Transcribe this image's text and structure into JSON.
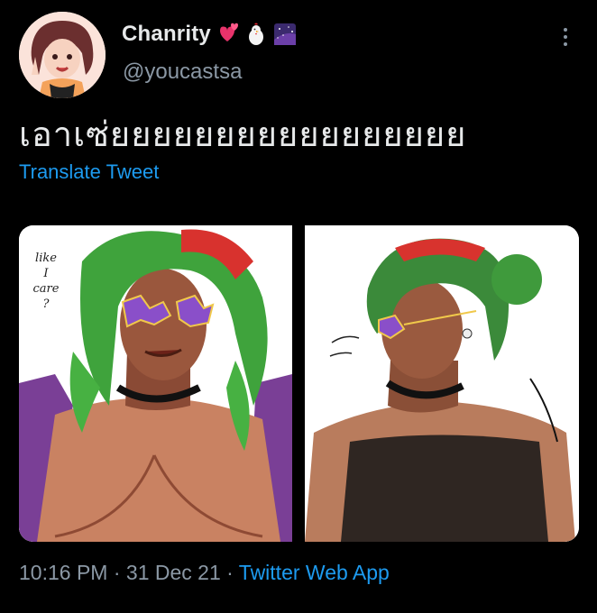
{
  "user": {
    "display_name": "Chanrity",
    "handle": "@youcastsa",
    "badges": [
      "heart-icon",
      "chicken-icon",
      "galaxy-icon"
    ]
  },
  "tweet": {
    "text": "เอาเซ่ยยยยยยยยยยยยยยยยย",
    "translate_label": "Translate Tweet"
  },
  "media": {
    "left_annotation": [
      "like",
      "I",
      "care",
      "?"
    ]
  },
  "footer": {
    "time": "10:16 PM",
    "sep1": " · ",
    "date": "31 Dec 21",
    "sep2": " · ",
    "app": "Twitter Web App"
  },
  "colors": {
    "background": "#000000",
    "text": "#e7e9ea",
    "muted": "#8b98a5",
    "link": "#1d9bf0"
  }
}
